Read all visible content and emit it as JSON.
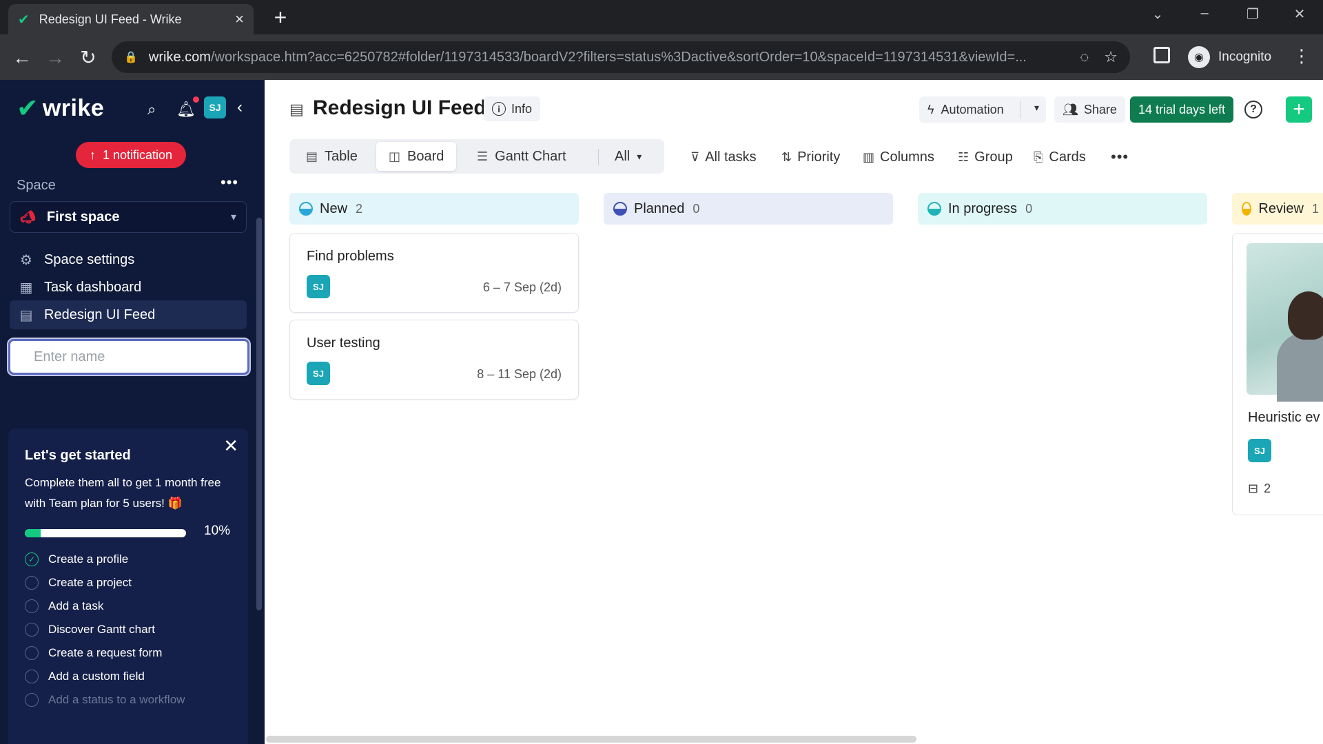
{
  "browser": {
    "tab_title": "Redesign UI Feed - Wrike",
    "url_host": "wrike.com",
    "url_path": "/workspace.htm?acc=6250782#folder/1197314533/boardV2?filters=status%3Dactive&sortOrder=10&spaceId=1197314531&viewId=...",
    "profile_label": "Incognito"
  },
  "sidebar": {
    "logo_text": "wrike",
    "avatar_initials": "SJ",
    "notification_pill": "1 notification",
    "space_label": "Space",
    "space_name": "First space",
    "items": [
      {
        "label": "Space settings"
      },
      {
        "label": "Task dashboard"
      },
      {
        "label": "Redesign UI Feed"
      }
    ],
    "name_input_placeholder": "Enter name",
    "onboarding": {
      "title": "Let's get started",
      "description": "Complete them all to get 1 month free with Team plan for 5 users! 🎁",
      "progress_percent": 10,
      "progress_label": "10%",
      "checklist": [
        {
          "label": "Create a profile",
          "done": true
        },
        {
          "label": "Create a project",
          "done": false
        },
        {
          "label": "Add a task",
          "done": false
        },
        {
          "label": "Discover Gantt chart",
          "done": false
        },
        {
          "label": "Create a request form",
          "done": false
        },
        {
          "label": "Add a custom field",
          "done": false
        },
        {
          "label": "Add a status to a workflow",
          "done": false
        }
      ]
    }
  },
  "header": {
    "title": "Redesign UI Feed",
    "info_label": "Info",
    "automation_label": "Automation",
    "share_label": "Share",
    "trial_label": "14 trial days left"
  },
  "views": {
    "tabs": [
      {
        "label": "Table"
      },
      {
        "label": "Board"
      },
      {
        "label": "Gantt Chart"
      }
    ],
    "all_label": "All"
  },
  "toolbar": {
    "all_tasks": "All tasks",
    "priority": "Priority",
    "columns": "Columns",
    "group": "Group",
    "cards": "Cards"
  },
  "board": {
    "columns": [
      {
        "name": "New",
        "count": "2",
        "color": "#e1f5fb",
        "status_color": "#2aa7d6"
      },
      {
        "name": "Planned",
        "count": "0",
        "color": "#e8ecf8",
        "status_color": "#3f51b5"
      },
      {
        "name": "In progress",
        "count": "0",
        "color": "#dff7f7",
        "status_color": "#1fb3b8"
      },
      {
        "name": "Review",
        "count": "1",
        "color": "#fff6d6",
        "status_color": "#f0b400"
      }
    ],
    "cards": [
      {
        "title": "Find problems",
        "assignee": "SJ",
        "dates": "6 – 7 Sep (2d)"
      },
      {
        "title": "User testing",
        "assignee": "SJ",
        "dates": "8 – 11 Sep (2d)"
      }
    ],
    "review_card": {
      "title": "Heuristic ev",
      "assignee": "SJ",
      "subtasks": "2"
    }
  },
  "colors": {
    "sidebar_bg": "#0f1a3a",
    "accent_green": "#14c980",
    "trial_green": "#0e7c4f",
    "notification_red": "#e5253b"
  }
}
